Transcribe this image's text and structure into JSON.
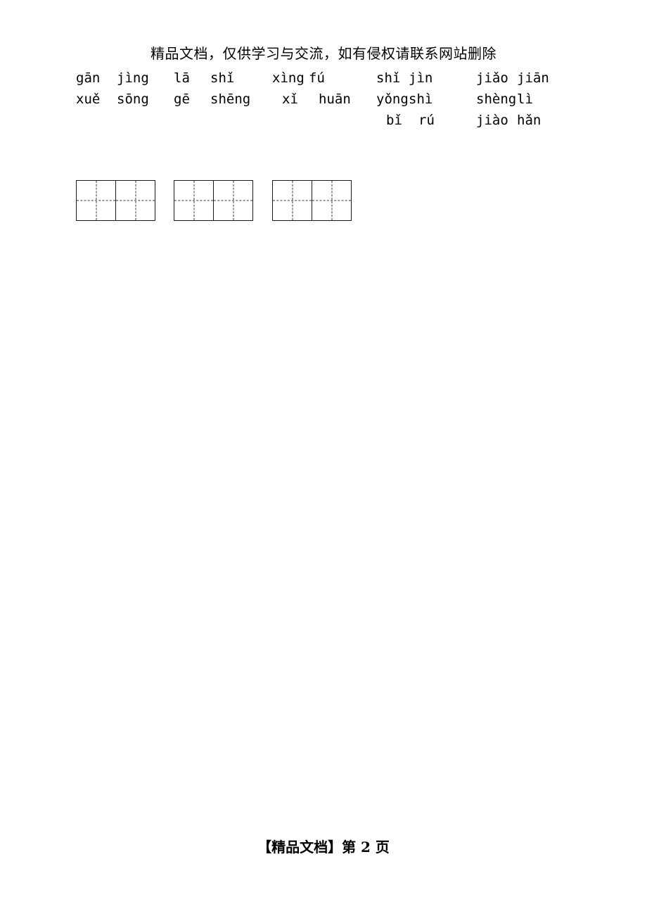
{
  "document": {
    "header_watermark": "精品文档，仅供学习与交流，如有侵权请联系网站删除",
    "footer_watermark": "【精品文档】第 2 页",
    "page_number": "2"
  },
  "worksheet": {
    "columns": [
      {
        "id": "col-1",
        "has_grid": true,
        "rows": [
          {
            "syllable_a": "gān",
            "syllable_b": "jìng"
          },
          {
            "syllable_a": "xuě",
            "syllable_b": "sōng"
          }
        ]
      },
      {
        "id": "col-2",
        "has_grid": true,
        "rows": [
          {
            "syllable_a": "lā",
            "syllable_b": "shǐ"
          },
          {
            "syllable_a": "gē",
            "syllable_b": "shēng"
          }
        ]
      },
      {
        "id": "col-3",
        "has_grid": true,
        "rows": [
          {
            "syllable_a": "xìng",
            "syllable_b": "fú"
          },
          {
            "syllable_a": "xǐ",
            "syllable_b": "huān"
          }
        ]
      },
      {
        "id": "col-4",
        "has_grid": false,
        "rows": [
          {
            "syllable_a": "shǐ",
            "syllable_b": "jìn"
          },
          {
            "syllable_a": "yǒng",
            "syllable_b": "shì"
          },
          {
            "syllable_a": "bǐ",
            "syllable_b": "rú"
          }
        ]
      },
      {
        "id": "col-5",
        "has_grid": false,
        "rows": [
          {
            "syllable_a": "jiǎo",
            "syllable_b": "jiān"
          },
          {
            "syllable_a": "shèng",
            "syllable_b": "lì"
          },
          {
            "syllable_a": "jiào",
            "syllable_b": "hǎn"
          }
        ]
      }
    ],
    "grids": [
      {
        "id": "grid-1",
        "cells": 2
      },
      {
        "id": "grid-2",
        "cells": 2
      },
      {
        "id": "grid-3",
        "cells": 2
      }
    ]
  },
  "colors": {
    "text": "#000000",
    "grid_border": "#1a1a1a",
    "grid_guide": "#3a3a3a",
    "page_background": "#ffffff"
  }
}
